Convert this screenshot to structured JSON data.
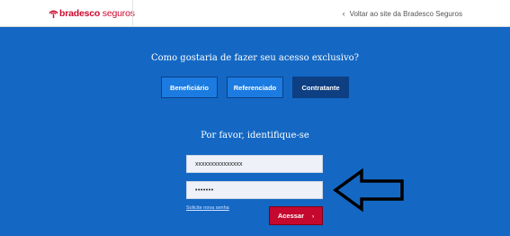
{
  "header": {
    "logo_text_bold": "bradesco",
    "logo_text_light": " seguros",
    "back_link_icon": "chevron-left-icon",
    "back_link_label": "Voltar ao site da Bradesco Seguros"
  },
  "access": {
    "question": "Como gostaria de fazer seu acesso exclusivo?",
    "roles": [
      "Beneficiário",
      "Referenciado",
      "Contratante"
    ],
    "selected_role": "Contratante"
  },
  "login": {
    "prompt": "Por favor, identifique-se",
    "user_value": "xxxxxxxxxxxxxxx",
    "password_value": "•••••••",
    "forgot_label": "Solicite nova senha",
    "submit_label": "Acessar",
    "submit_icon": "chevron-right-icon"
  },
  "colors": {
    "brand_red": "#cc092f",
    "main_blue": "#1468c4",
    "selected_role_blue": "#0d3f82",
    "role_blue": "#1b7be0"
  },
  "annotation": {
    "icon": "arrow-left-outline-icon",
    "color": "#000000"
  }
}
